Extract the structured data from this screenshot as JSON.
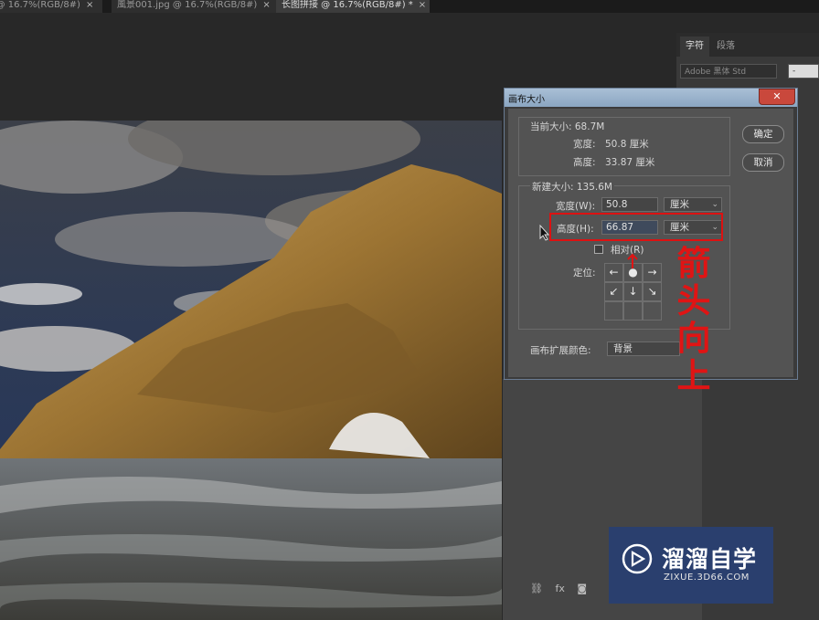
{
  "tabs": [
    {
      "label": "0 @ 16.7%(RGB/8#)",
      "close": "×"
    },
    {
      "label": "風景001.jpg @ 16.7%(RGB/8#)",
      "close": "×"
    },
    {
      "label": "长图拼接 @ 16.7%(RGB/8#) *",
      "close": "×"
    }
  ],
  "right_panel": {
    "tabs": [
      "字符",
      "段落"
    ],
    "font_family": "Adobe 黑体 Std",
    "font_style": "-"
  },
  "dialog": {
    "title": "画布大小",
    "close_glyph": "✕",
    "current": {
      "size_label": "当前大小: 68.7M",
      "width_label": "宽度:",
      "width_value": "50.8 厘米",
      "height_label": "高度:",
      "height_value": "33.87 厘米"
    },
    "new": {
      "size_label": "新建大小: 135.6M",
      "width_label": "宽度(W):",
      "width_value": "50.8",
      "width_unit": "厘米",
      "height_label": "高度(H):",
      "height_value": "66.87",
      "height_unit": "厘米",
      "relative_label": "相对(R)",
      "anchor_label": "定位:"
    },
    "extension_color_label": "画布扩展颜色:",
    "extension_color_value": "背景",
    "ok_label": "确定",
    "cancel_label": "取消"
  },
  "annotation": {
    "text_lines": [
      "箭",
      "头",
      "向",
      "上"
    ],
    "color": "#e01414"
  },
  "bottom_icons": [
    "link-icon",
    "fx-icon",
    "mask-icon"
  ],
  "bottom_fx": "fx",
  "watermark": {
    "title": "溜溜自学",
    "url": "ZIXUE.3D66.COM"
  }
}
